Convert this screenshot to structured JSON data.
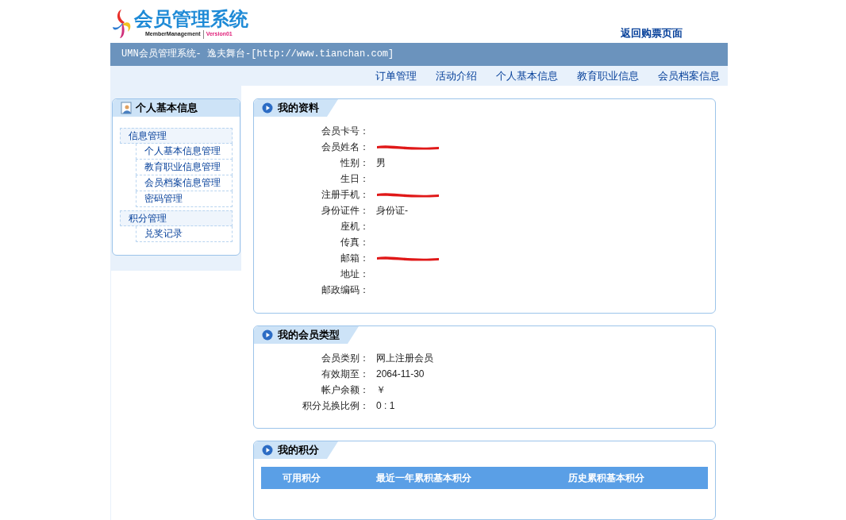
{
  "logo": {
    "title": "会员管理系统",
    "subtitle": "MemberManagement",
    "version": "Version01"
  },
  "back_link": "返回购票页面",
  "banner": {
    "title": "UMN会员管理系统- 逸夫舞台-[http://www.tianchan.com]"
  },
  "nav": [
    "订单管理",
    "活动介绍",
    "个人基本信息",
    "教育职业信息",
    "会员档案信息"
  ],
  "sidebar": {
    "title": "个人基本信息",
    "groups": [
      {
        "label": "信息管理",
        "children": [
          {
            "label": "个人基本信息管理"
          },
          {
            "label": "教育职业信息管理"
          },
          {
            "label": "会员档案信息管理"
          },
          {
            "label": "密码管理"
          }
        ]
      },
      {
        "label": "积分管理",
        "children": [
          {
            "label": "兑奖记录"
          }
        ]
      }
    ]
  },
  "profile": {
    "title": "我的资料",
    "rows": [
      {
        "label": "会员卡号：",
        "redacted": false
      },
      {
        "label": "会员姓名：",
        "redacted": true
      },
      {
        "label": "性别：",
        "value": "男",
        "redacted": false
      },
      {
        "label": "生日：",
        "redacted": false
      },
      {
        "label": "注册手机：",
        "redacted": true
      },
      {
        "label": "身份证件：",
        "value": "身份证-",
        "redacted": false
      },
      {
        "label": "座机：",
        "redacted": false
      },
      {
        "label": "传真：",
        "redacted": false
      },
      {
        "label": "邮箱：",
        "redacted": true
      },
      {
        "label": "地址：",
        "redacted": false
      },
      {
        "label": "邮政编码：",
        "redacted": false
      }
    ]
  },
  "membership": {
    "title": "我的会员类型",
    "rows": [
      {
        "label": "会员类别：",
        "value": "网上注册会员"
      },
      {
        "label": "有效期至：",
        "value": "2064-11-30"
      },
      {
        "label": "帐户余额：",
        "value": "￥"
      },
      {
        "label": "积分兑换比例：",
        "value": "0 : 1"
      }
    ]
  },
  "points": {
    "title": "我的积分",
    "columns": [
      "可用积分",
      "最近一年累积基本积分",
      "历史累积基本积分"
    ]
  }
}
